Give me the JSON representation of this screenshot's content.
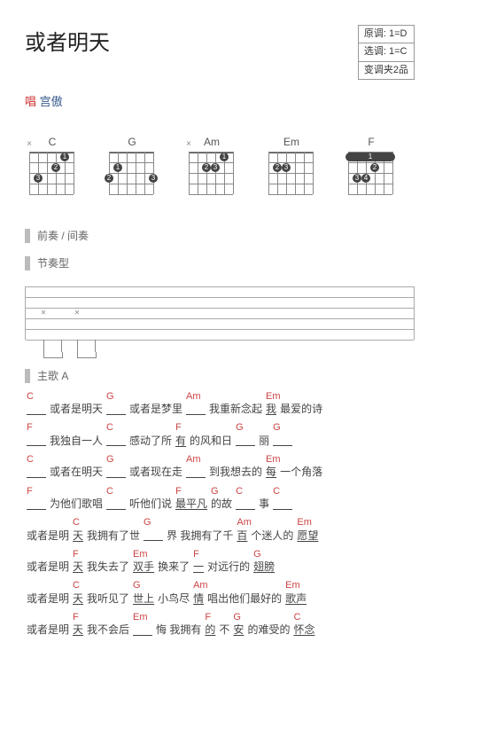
{
  "header": {
    "title": "或者明天",
    "meta": {
      "original_key": "原调: 1=D",
      "selected_key": "选调: 1=C",
      "capo": "变调夹2品"
    },
    "singer_label": "唱",
    "singer_name": "宫傲"
  },
  "chords": {
    "names": [
      "C",
      "G",
      "Am",
      "Em",
      "F"
    ]
  },
  "sections": {
    "intro": "前奏 / 间奏",
    "rhythm": "节奏型",
    "verseA": "主歌 A"
  },
  "chart_data": {
    "type": "table",
    "title": "Guitar chord tab with lyrics — 或者明天 (宫傲)",
    "keys": {
      "original": "D",
      "selected": "C",
      "capo_fret": 2
    },
    "chord_diagrams": [
      {
        "name": "C",
        "frets_EADGBE": [
          "x",
          3,
          2,
          0,
          1,
          0
        ]
      },
      {
        "name": "G",
        "frets_EADGBE": [
          3,
          2,
          0,
          0,
          0,
          3
        ]
      },
      {
        "name": "Am",
        "frets_EADGBE": [
          "x",
          0,
          2,
          2,
          1,
          0
        ]
      },
      {
        "name": "Em",
        "frets_EADGBE": [
          0,
          2,
          2,
          0,
          0,
          0
        ]
      },
      {
        "name": "F",
        "frets_EADGBE": [
          1,
          3,
          3,
          2,
          1,
          1
        ],
        "barre": {
          "fret": 1,
          "from": 1,
          "to": 6
        }
      }
    ],
    "lyric_lines": [
      {
        "parts": [
          {
            "chord": "C",
            "blank": true
          },
          {
            "text": "或者是明天"
          },
          {
            "chord": "G",
            "blank": true
          },
          {
            "text": "或者是梦里"
          },
          {
            "chord": "Am",
            "blank": true
          },
          {
            "text": "我重新念起"
          },
          {
            "chord": "Em",
            "text": "我",
            "underline": true
          },
          {
            "text": "最爱的诗"
          }
        ]
      },
      {
        "parts": [
          {
            "chord": "F",
            "blank": true
          },
          {
            "text": "我独自一人"
          },
          {
            "chord": "C",
            "blank": true
          },
          {
            "text": "感动了所"
          },
          {
            "chord": "F",
            "text": "有",
            "underline": true
          },
          {
            "text": "的风和日"
          },
          {
            "chord": "G",
            "blank": true
          },
          {
            "text": "丽"
          },
          {
            "chord": "G",
            "blank": true
          }
        ]
      },
      {
        "parts": [
          {
            "chord": "C",
            "blank": true
          },
          {
            "text": "或者在明天"
          },
          {
            "chord": "G",
            "blank": true
          },
          {
            "text": "或者现在走"
          },
          {
            "chord": "Am",
            "blank": true
          },
          {
            "text": "到我想去的"
          },
          {
            "chord": "Em",
            "text": "每",
            "underline": true
          },
          {
            "text": "一个角落"
          }
        ]
      },
      {
        "parts": [
          {
            "chord": "F",
            "blank": true
          },
          {
            "text": "为他们歌唱"
          },
          {
            "chord": "C",
            "blank": true
          },
          {
            "text": "听他们说"
          },
          {
            "chord": "F",
            "text": "最平凡",
            "underline": true
          },
          {
            "chord": "G",
            "text": "的故"
          },
          {
            "chord": "C",
            "blank": true
          },
          {
            "text": "事"
          },
          {
            "chord": "C",
            "blank": true
          }
        ]
      },
      {
        "parts": [
          {
            "text": "或者是明"
          },
          {
            "chord": "C",
            "text": "天",
            "underline": true
          },
          {
            "text": " 我拥有了世"
          },
          {
            "chord": "G",
            "blank": true
          },
          {
            "text": "界 我拥有了千"
          },
          {
            "chord": "Am",
            "text": "百",
            "underline": true
          },
          {
            "text": "个迷人的"
          },
          {
            "chord": "Em",
            "text": "愿望",
            "underline": true
          }
        ]
      },
      {
        "parts": [
          {
            "text": "或者是明"
          },
          {
            "chord": "F",
            "text": "天",
            "underline": true
          },
          {
            "text": " 我失去了"
          },
          {
            "chord": "Em",
            "text": "双手",
            "underline": true
          },
          {
            "text": " 换来了"
          },
          {
            "chord": "F",
            "text": "一",
            "underline": true
          },
          {
            "text": "对远行的"
          },
          {
            "chord": "G",
            "text": "翅膀",
            "underline": true
          }
        ]
      },
      {
        "parts": [
          {
            "text": "或者是明"
          },
          {
            "chord": "C",
            "text": "天",
            "underline": true
          },
          {
            "text": " 我听见了"
          },
          {
            "chord": "G",
            "text": "世上",
            "underline": true
          },
          {
            "text": " 小鸟尽"
          },
          {
            "chord": "Am",
            "text": "情",
            "underline": true
          },
          {
            "text": "唱出他们最好的"
          },
          {
            "chord": "Em",
            "text": "歌声",
            "underline": true
          }
        ]
      },
      {
        "parts": [
          {
            "text": "或者是明"
          },
          {
            "chord": "F",
            "text": "天",
            "underline": true
          },
          {
            "text": " 我不会后"
          },
          {
            "chord": "Em",
            "blank": true
          },
          {
            "text": "悔 我拥有"
          },
          {
            "chord": "F",
            "text": "的",
            "underline": true
          },
          {
            "text": "不"
          },
          {
            "chord": "G",
            "text": "安",
            "underline": true
          },
          {
            "text": "的难受的"
          },
          {
            "chord": "C",
            "text": "怀念",
            "underline": true
          }
        ]
      }
    ]
  }
}
